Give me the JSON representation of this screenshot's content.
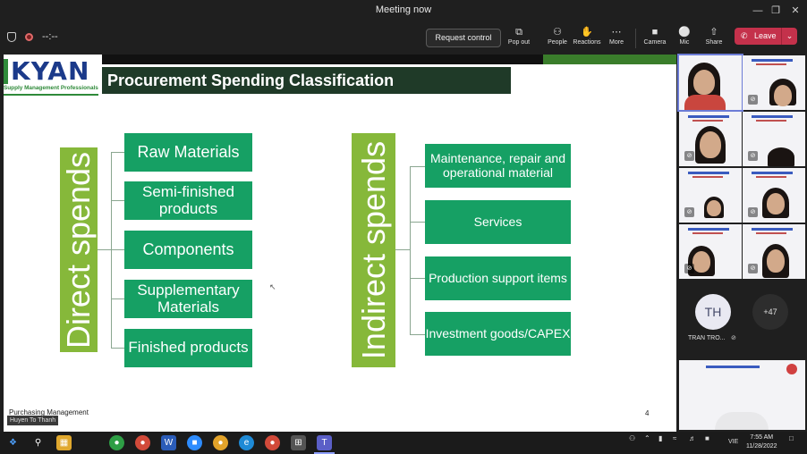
{
  "window": {
    "title": "Meeting now"
  },
  "toolbar": {
    "timer": "--:--",
    "request_control": "Request control",
    "tools": [
      {
        "label": "Pop out",
        "icon": "pop-out-icon"
      },
      {
        "label": "People",
        "icon": "people-icon"
      },
      {
        "label": "Reactions",
        "icon": "reactions-icon"
      },
      {
        "label": "More",
        "icon": "more-icon"
      },
      {
        "label": "Camera",
        "icon": "camera-icon"
      },
      {
        "label": "Mic",
        "icon": "mic-off-icon"
      },
      {
        "label": "Share",
        "icon": "share-icon"
      }
    ],
    "leave": "Leave"
  },
  "slide": {
    "logo_text": "KYAN",
    "logo_tagline": "Supply Management Professionals",
    "title": "Procurement Spending Classification",
    "direct_label": "Direct spends",
    "direct_items": [
      "Raw Materials",
      "Semi-finished products",
      "Components",
      "Supplementary Materials",
      "Finished products"
    ],
    "indirect_label": "Indirect spends",
    "indirect_items": [
      "Maintenance, repair and operational material",
      "Services",
      "Production support items",
      "Investment goods/CAPEX"
    ],
    "footer_left": "Purchasing Management",
    "presenter_name": "Huyen To Thanh",
    "page_number": "4",
    "colors": {
      "green_box": "#16a064",
      "lime_bar": "#86b83a",
      "title_bg": "#1f3a28"
    }
  },
  "gallery": {
    "initials": "TH",
    "participant_name": "TRAN TRO...",
    "more_count": "+47"
  },
  "taskbar": {
    "time": "7:55 AM",
    "date": "11/28/2022",
    "lang": "VIE"
  }
}
